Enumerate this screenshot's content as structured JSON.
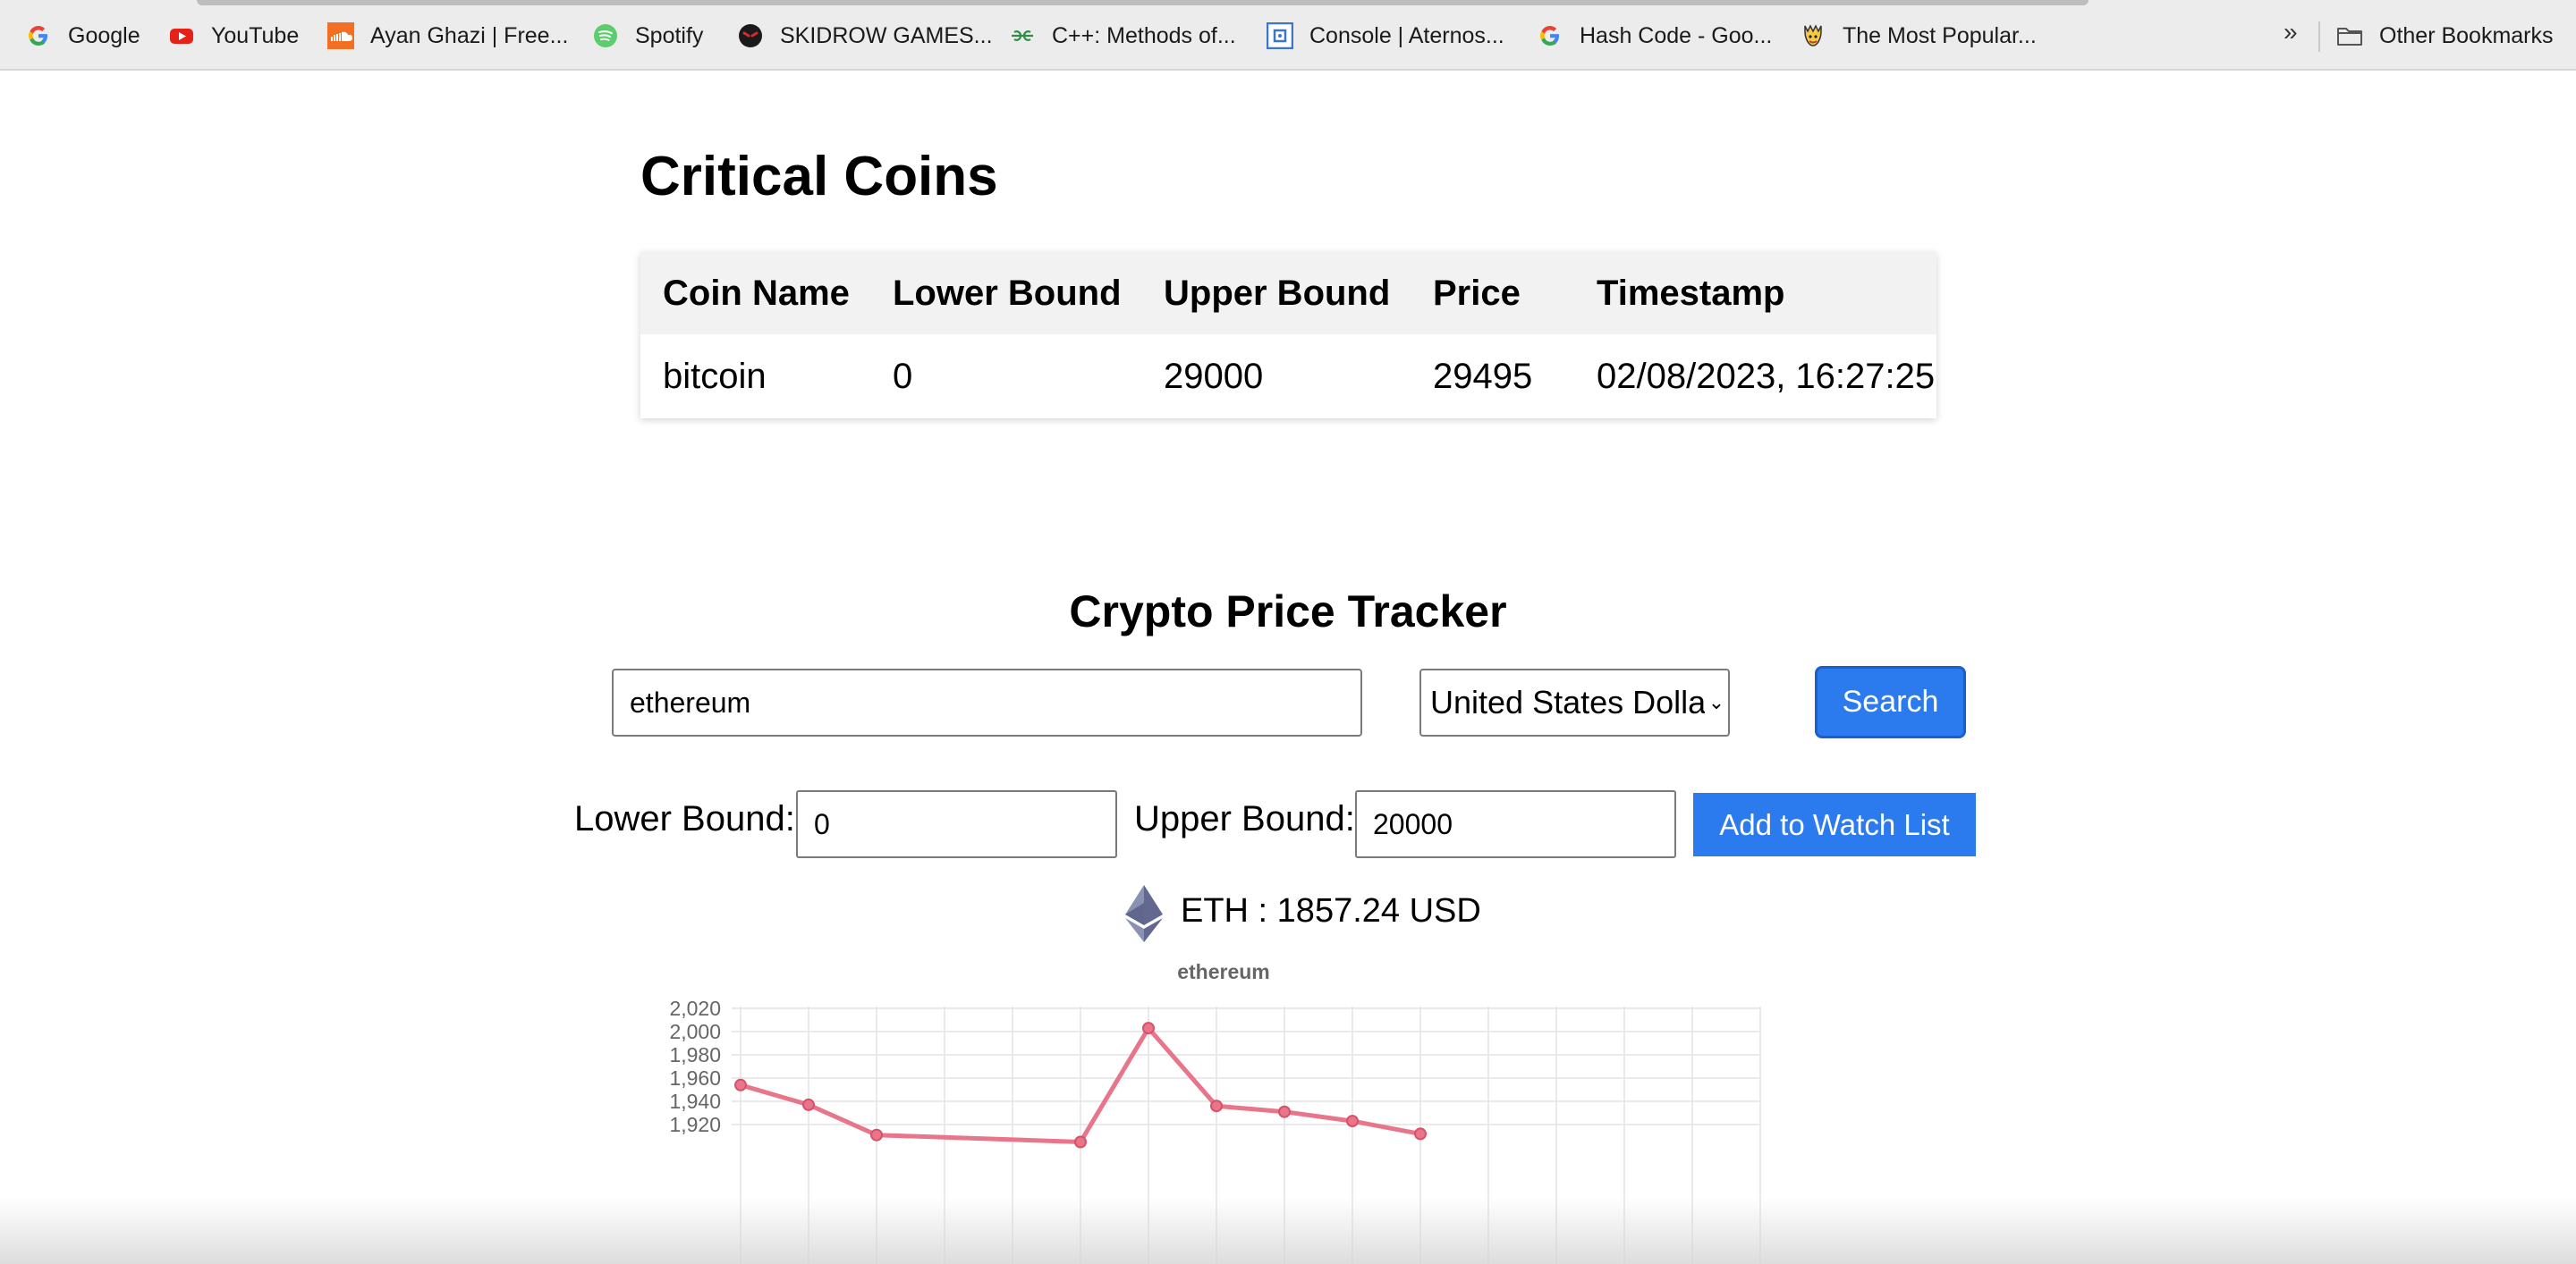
{
  "bookmarks": {
    "items": [
      {
        "label": "Google",
        "icon": "google-icon"
      },
      {
        "label": "YouTube",
        "icon": "youtube-icon"
      },
      {
        "label": "Ayan Ghazi | Free...",
        "icon": "soundcloud-icon"
      },
      {
        "label": "Spotify",
        "icon": "spotify-icon"
      },
      {
        "label": "SKIDROW GAMES...",
        "icon": "skidrow-icon"
      },
      {
        "label": "C++: Methods of...",
        "icon": "geeksforgeeks-icon"
      },
      {
        "label": "Console | Aternos...",
        "icon": "aternos-icon"
      },
      {
        "label": "Hash Code - Goo...",
        "icon": "google-icon"
      },
      {
        "label": "The Most Popular...",
        "icon": "popular-site-icon"
      }
    ],
    "overflow": "»",
    "other_bookmarks": "Other Bookmarks"
  },
  "critical": {
    "title": "Critical Coins",
    "columns": [
      "Coin Name",
      "Lower Bound",
      "Upper Bound",
      "Price",
      "Timestamp"
    ],
    "rows": [
      [
        "bitcoin",
        "0",
        "29000",
        "29495",
        "02/08/2023, 16:27:25"
      ]
    ]
  },
  "tracker": {
    "title": "Crypto Price Tracker",
    "search_value": "ethereum",
    "currency_value": "United States Dollar (U",
    "search_label": "Search",
    "lower_label": "Lower Bound:",
    "lower_value": "0",
    "upper_label": "Upper Bound:",
    "upper_value": "20000",
    "watch_label": "Add to Watch List",
    "price_text": "ETH : 1857.24 USD"
  },
  "colors": {
    "accent": "#2b7bef",
    "line": "#e8758a"
  },
  "chart_data": {
    "type": "line",
    "title": "ethereum",
    "series": [
      {
        "name": "ethereum",
        "values": [
          1954,
          1937,
          1911,
          null,
          null,
          1905,
          2003,
          1936,
          1931,
          1923,
          1912
        ]
      }
    ],
    "y_ticks": [
      1920,
      1940,
      1960,
      1980,
      2000,
      2020
    ],
    "ylim": [
      1909,
      2020
    ],
    "grid": true
  }
}
